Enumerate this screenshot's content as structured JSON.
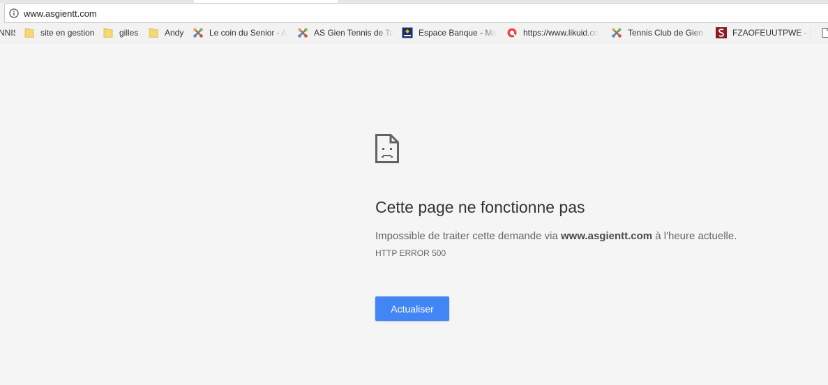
{
  "address_bar": {
    "url": "www.asgientt.com",
    "info_icon": "info-circle-icon"
  },
  "bookmarks": [
    {
      "label": "NNIS",
      "icon": "none"
    },
    {
      "label": "site en gestion",
      "icon": "folder-icon"
    },
    {
      "label": "gilles",
      "icon": "folder-icon"
    },
    {
      "label": "Andy",
      "icon": "folder-icon"
    },
    {
      "label": "Le coin du Senior - A",
      "icon": "joomla-icon"
    },
    {
      "label": "AS Gien Tennis de Tab",
      "icon": "joomla-icon"
    },
    {
      "label": "Espace Banque - Mac",
      "icon": "bank-icon"
    },
    {
      "label": "https://www.likuid.co",
      "icon": "likuid-icon"
    },
    {
      "label": "Tennis Club de Gien -",
      "icon": "joomla-icon"
    },
    {
      "label": "FZAOFEUUTPWE - SC",
      "icon": "s-logo-icon"
    },
    {
      "label": "",
      "icon": "page-icon"
    }
  ],
  "error": {
    "icon": "sad-page-icon",
    "title": "Cette page ne fonctionne pas",
    "desc_prefix": "Impossible de traiter cette demande via ",
    "desc_domain": "www.asgientt.com",
    "desc_suffix": " à l'heure actuelle.",
    "code": "HTTP ERROR 500",
    "button_label": "Actualiser"
  },
  "colors": {
    "page_bg": "#f5f5f5",
    "button_bg": "#4285f4",
    "folder": "#f7d774"
  }
}
